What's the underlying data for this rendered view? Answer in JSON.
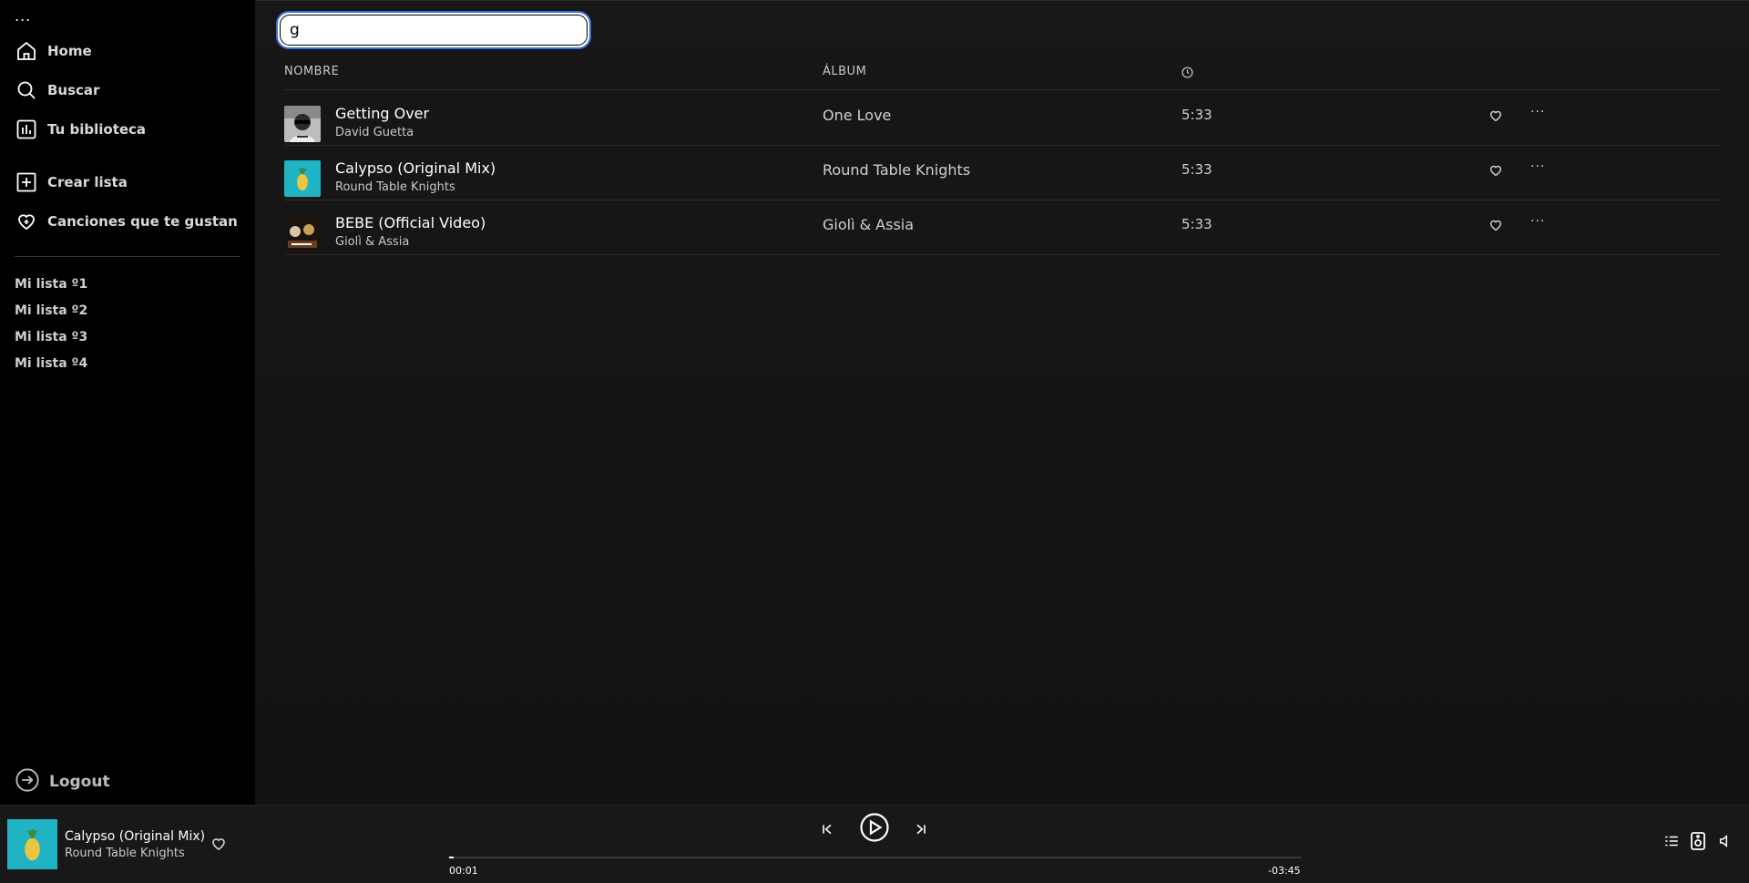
{
  "sidebar": {
    "menu_dots": "...",
    "nav": [
      {
        "label": "Home"
      },
      {
        "label": "Buscar"
      },
      {
        "label": "Tu biblioteca"
      },
      {
        "label": "Crear lista"
      },
      {
        "label": "Canciones que te gustan"
      }
    ],
    "playlists": [
      "Mi lista º1",
      "Mi lista º2",
      "Mi lista º3",
      "Mi lista º4"
    ],
    "logout_label": "Logout"
  },
  "search": {
    "value": "g"
  },
  "table": {
    "headers": {
      "name": "NOMBRE",
      "album": "ÁLBUM"
    },
    "rows": [
      {
        "title": "Getting Over",
        "artist": "David Guetta",
        "album": "One Love",
        "duration": "5:33",
        "more": "···"
      },
      {
        "title": "Calypso (Original Mix)",
        "artist": "Round Table Knights",
        "album": "Round Table Knights",
        "duration": "5:33",
        "more": "···"
      },
      {
        "title": "BEBE (Official Video)",
        "artist": "Giolì & Assia",
        "album": "Giolì & Assia",
        "duration": "5:33",
        "more": "···"
      }
    ]
  },
  "player": {
    "title": "Calypso (Original Mix)",
    "artist": "Round Table Knights",
    "elapsed": "00:01",
    "remaining": "-03:45",
    "progress": 0.005
  },
  "colors": {
    "focus_ring": "#3b6fd8",
    "calypso_cover": "#1fb3c4"
  }
}
